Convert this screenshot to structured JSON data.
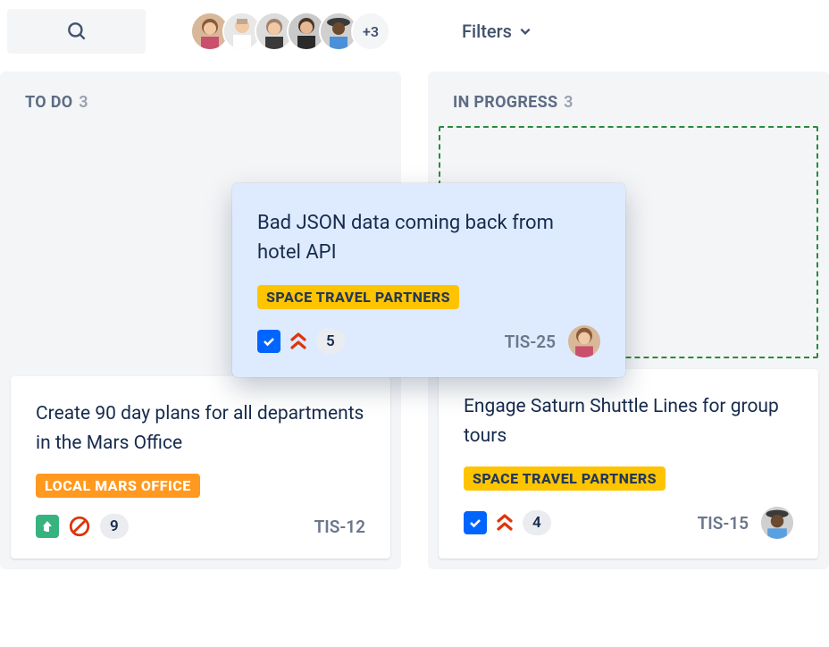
{
  "topbar": {
    "avatar_overflow": "+3",
    "filters_label": "Filters"
  },
  "columns": {
    "todo": {
      "label": "TO DO",
      "count": "3"
    },
    "inprogress": {
      "label": "IN PROGRESS",
      "count": "3"
    }
  },
  "drag_card": {
    "title": "Bad JSON data coming back from hotel API",
    "tag": "SPACE TRAVEL PARTNERS",
    "points": "5",
    "key": "TIS-25"
  },
  "cards": {
    "todo_1": {
      "title": "Create 90 day plans for all departments in the Mars Office",
      "tag": "LOCAL MARS OFFICE",
      "points": "9",
      "key": "TIS-12"
    },
    "inprogress_1": {
      "title": "Engage Saturn Shuttle Lines for group tours",
      "tag": "SPACE TRAVEL PARTNERS",
      "points": "4",
      "key": "TIS-15"
    }
  }
}
